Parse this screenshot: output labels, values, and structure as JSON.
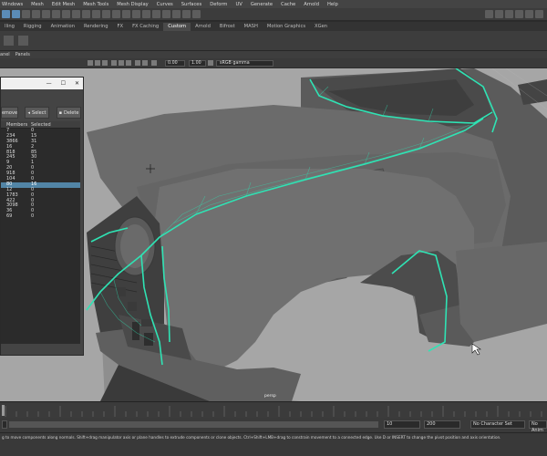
{
  "menubar": [
    "Windows",
    "Mesh",
    "Edit Mesh",
    "Mesh Tools",
    "Mesh Display",
    "Curves",
    "Surfaces",
    "Deform",
    "UV",
    "Generate",
    "Cache",
    "Arnold",
    "Help"
  ],
  "shelf_tabs": [
    {
      "label": "lling",
      "active": false
    },
    {
      "label": "Rigging",
      "active": false
    },
    {
      "label": "Animation",
      "active": false
    },
    {
      "label": "Rendering",
      "active": false
    },
    {
      "label": "FX",
      "active": false
    },
    {
      "label": "FX Caching",
      "active": false
    },
    {
      "label": "Custom",
      "active": true
    },
    {
      "label": "Arnold",
      "active": false
    },
    {
      "label": "Bifrost",
      "active": false
    },
    {
      "label": "MASH",
      "active": false
    },
    {
      "label": "Motion Graphics",
      "active": false
    },
    {
      "label": "XGen",
      "active": false
    }
  ],
  "panel_menu": [
    "anel",
    "Panels"
  ],
  "viewport_toolbar": {
    "field_a": "0.00",
    "field_b": "1.00",
    "color_space": "sRGB gamma"
  },
  "viewport": {
    "camera_label": "persp",
    "background": "#a6a6a6",
    "wire_color": "#2fe3b4"
  },
  "dialog": {
    "buttons": {
      "remove": "emove",
      "select": "Select",
      "delete": "Delete"
    },
    "columns": {
      "members": "Members",
      "selected": "Selected"
    },
    "rows": [
      {
        "members": "7",
        "selected": "0",
        "selected_row": false
      },
      {
        "members": "234",
        "selected": "15",
        "selected_row": false
      },
      {
        "members": "3866",
        "selected": "31",
        "selected_row": false
      },
      {
        "members": "16",
        "selected": "2",
        "selected_row": false
      },
      {
        "members": "818",
        "selected": "85",
        "selected_row": false
      },
      {
        "members": "245",
        "selected": "30",
        "selected_row": false
      },
      {
        "members": "9",
        "selected": "1",
        "selected_row": false
      },
      {
        "members": "20",
        "selected": "0",
        "selected_row": false
      },
      {
        "members": "918",
        "selected": "0",
        "selected_row": false
      },
      {
        "members": "104",
        "selected": "0",
        "selected_row": false
      },
      {
        "members": "80",
        "selected": "16",
        "selected_row": true
      },
      {
        "members": "12",
        "selected": "0",
        "selected_row": false
      },
      {
        "members": "1783",
        "selected": "0",
        "selected_row": false
      },
      {
        "members": "422",
        "selected": "0",
        "selected_row": false
      },
      {
        "members": "3098",
        "selected": "0",
        "selected_row": false
      },
      {
        "members": "36",
        "selected": "0",
        "selected_row": false
      },
      {
        "members": "69",
        "selected": "0",
        "selected_row": false
      }
    ]
  },
  "range": {
    "start": "10",
    "end": "200",
    "character_set": "No Character Set",
    "anim_layer": "No Anim"
  },
  "helpline": "g to move components along normals. Shift+drag manipulator axis or plane handles to extrude components or clone objects. Ctrl+Shift+LMB+drag to constrain movement to a connected edge. Use D or INSERT to change the pivot position and axis orientation."
}
